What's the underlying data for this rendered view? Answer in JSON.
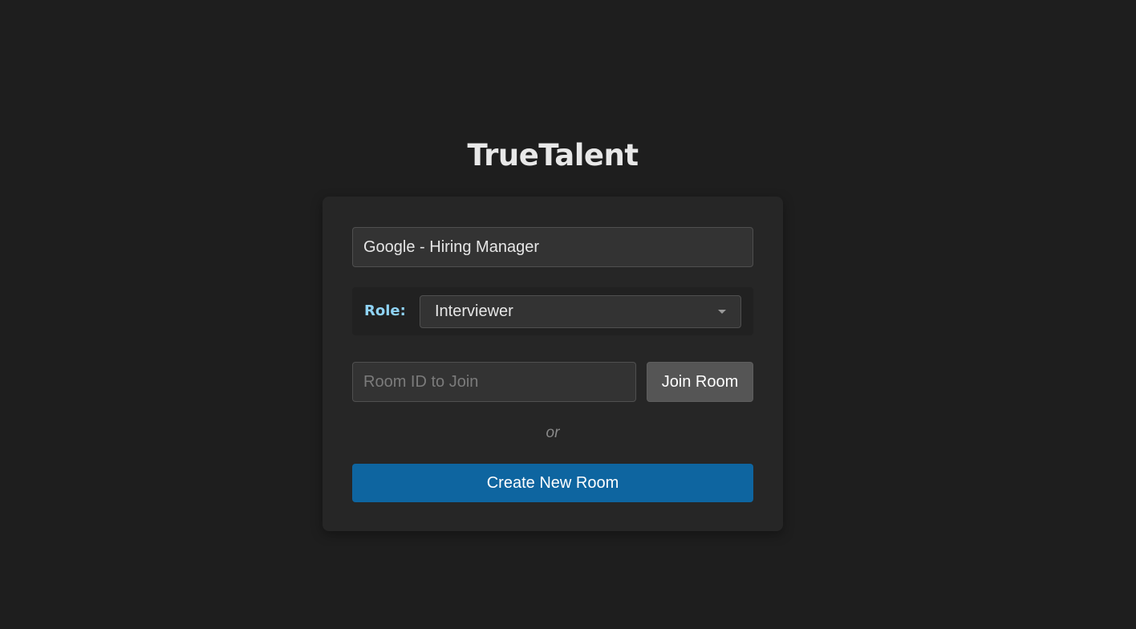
{
  "app": {
    "title": "TrueTalent"
  },
  "form": {
    "name_value": "Google - Hiring Manager",
    "role_label": "Role:",
    "role_selected": "Interviewer",
    "room_id_placeholder": "Room ID to Join",
    "room_id_value": "",
    "join_label": "Join Room",
    "or_text": "or",
    "create_label": "Create New Room"
  },
  "icons": {
    "role_dropdown": "chevron-down-icon"
  },
  "colors": {
    "background": "#1e1e1e",
    "card": "#262626",
    "accent": "#0e65a0",
    "role_label": "#8fd3f5",
    "secondary_button": "#555555"
  }
}
